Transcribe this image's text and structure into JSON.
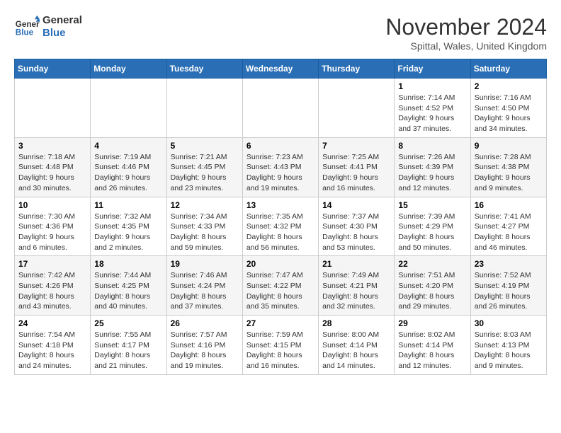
{
  "logo": {
    "line1": "General",
    "line2": "Blue"
  },
  "title": "November 2024",
  "location": "Spittal, Wales, United Kingdom",
  "weekdays": [
    "Sunday",
    "Monday",
    "Tuesday",
    "Wednesday",
    "Thursday",
    "Friday",
    "Saturday"
  ],
  "weeks": [
    [
      {
        "day": "",
        "info": ""
      },
      {
        "day": "",
        "info": ""
      },
      {
        "day": "",
        "info": ""
      },
      {
        "day": "",
        "info": ""
      },
      {
        "day": "",
        "info": ""
      },
      {
        "day": "1",
        "info": "Sunrise: 7:14 AM\nSunset: 4:52 PM\nDaylight: 9 hours\nand 37 minutes."
      },
      {
        "day": "2",
        "info": "Sunrise: 7:16 AM\nSunset: 4:50 PM\nDaylight: 9 hours\nand 34 minutes."
      }
    ],
    [
      {
        "day": "3",
        "info": "Sunrise: 7:18 AM\nSunset: 4:48 PM\nDaylight: 9 hours\nand 30 minutes."
      },
      {
        "day": "4",
        "info": "Sunrise: 7:19 AM\nSunset: 4:46 PM\nDaylight: 9 hours\nand 26 minutes."
      },
      {
        "day": "5",
        "info": "Sunrise: 7:21 AM\nSunset: 4:45 PM\nDaylight: 9 hours\nand 23 minutes."
      },
      {
        "day": "6",
        "info": "Sunrise: 7:23 AM\nSunset: 4:43 PM\nDaylight: 9 hours\nand 19 minutes."
      },
      {
        "day": "7",
        "info": "Sunrise: 7:25 AM\nSunset: 4:41 PM\nDaylight: 9 hours\nand 16 minutes."
      },
      {
        "day": "8",
        "info": "Sunrise: 7:26 AM\nSunset: 4:39 PM\nDaylight: 9 hours\nand 12 minutes."
      },
      {
        "day": "9",
        "info": "Sunrise: 7:28 AM\nSunset: 4:38 PM\nDaylight: 9 hours\nand 9 minutes."
      }
    ],
    [
      {
        "day": "10",
        "info": "Sunrise: 7:30 AM\nSunset: 4:36 PM\nDaylight: 9 hours\nand 6 minutes."
      },
      {
        "day": "11",
        "info": "Sunrise: 7:32 AM\nSunset: 4:35 PM\nDaylight: 9 hours\nand 2 minutes."
      },
      {
        "day": "12",
        "info": "Sunrise: 7:34 AM\nSunset: 4:33 PM\nDaylight: 8 hours\nand 59 minutes."
      },
      {
        "day": "13",
        "info": "Sunrise: 7:35 AM\nSunset: 4:32 PM\nDaylight: 8 hours\nand 56 minutes."
      },
      {
        "day": "14",
        "info": "Sunrise: 7:37 AM\nSunset: 4:30 PM\nDaylight: 8 hours\nand 53 minutes."
      },
      {
        "day": "15",
        "info": "Sunrise: 7:39 AM\nSunset: 4:29 PM\nDaylight: 8 hours\nand 50 minutes."
      },
      {
        "day": "16",
        "info": "Sunrise: 7:41 AM\nSunset: 4:27 PM\nDaylight: 8 hours\nand 46 minutes."
      }
    ],
    [
      {
        "day": "17",
        "info": "Sunrise: 7:42 AM\nSunset: 4:26 PM\nDaylight: 8 hours\nand 43 minutes."
      },
      {
        "day": "18",
        "info": "Sunrise: 7:44 AM\nSunset: 4:25 PM\nDaylight: 8 hours\nand 40 minutes."
      },
      {
        "day": "19",
        "info": "Sunrise: 7:46 AM\nSunset: 4:24 PM\nDaylight: 8 hours\nand 37 minutes."
      },
      {
        "day": "20",
        "info": "Sunrise: 7:47 AM\nSunset: 4:22 PM\nDaylight: 8 hours\nand 35 minutes."
      },
      {
        "day": "21",
        "info": "Sunrise: 7:49 AM\nSunset: 4:21 PM\nDaylight: 8 hours\nand 32 minutes."
      },
      {
        "day": "22",
        "info": "Sunrise: 7:51 AM\nSunset: 4:20 PM\nDaylight: 8 hours\nand 29 minutes."
      },
      {
        "day": "23",
        "info": "Sunrise: 7:52 AM\nSunset: 4:19 PM\nDaylight: 8 hours\nand 26 minutes."
      }
    ],
    [
      {
        "day": "24",
        "info": "Sunrise: 7:54 AM\nSunset: 4:18 PM\nDaylight: 8 hours\nand 24 minutes."
      },
      {
        "day": "25",
        "info": "Sunrise: 7:55 AM\nSunset: 4:17 PM\nDaylight: 8 hours\nand 21 minutes."
      },
      {
        "day": "26",
        "info": "Sunrise: 7:57 AM\nSunset: 4:16 PM\nDaylight: 8 hours\nand 19 minutes."
      },
      {
        "day": "27",
        "info": "Sunrise: 7:59 AM\nSunset: 4:15 PM\nDaylight: 8 hours\nand 16 minutes."
      },
      {
        "day": "28",
        "info": "Sunrise: 8:00 AM\nSunset: 4:14 PM\nDaylight: 8 hours\nand 14 minutes."
      },
      {
        "day": "29",
        "info": "Sunrise: 8:02 AM\nSunset: 4:14 PM\nDaylight: 8 hours\nand 12 minutes."
      },
      {
        "day": "30",
        "info": "Sunrise: 8:03 AM\nSunset: 4:13 PM\nDaylight: 8 hours\nand 9 minutes."
      }
    ]
  ]
}
